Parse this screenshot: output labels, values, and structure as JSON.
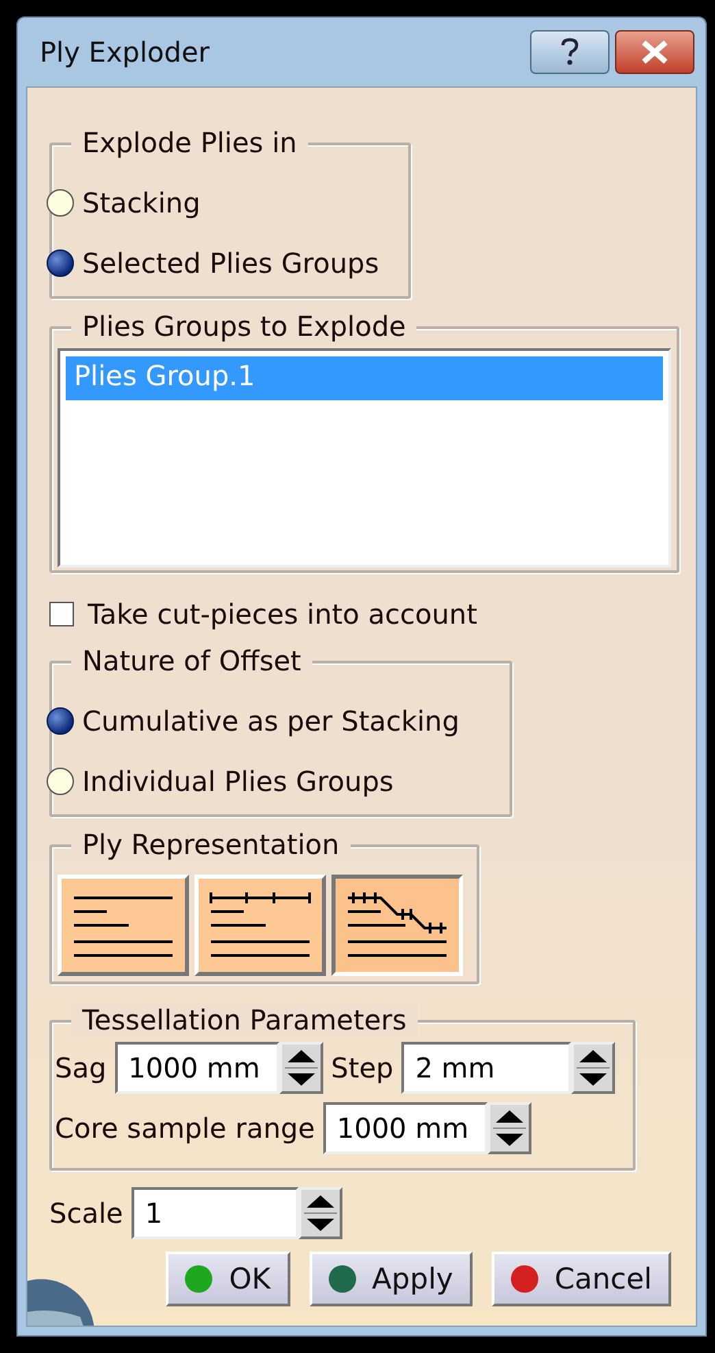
{
  "window": {
    "title": "Ply Exploder"
  },
  "explode_plies_in": {
    "legend": "Explode Plies in",
    "options": [
      {
        "label": "Stacking",
        "selected": false
      },
      {
        "label": "Selected Plies Groups",
        "selected": true
      }
    ]
  },
  "plies_groups_to_explode": {
    "legend": "Plies Groups to Explode",
    "items": [
      {
        "label": "Plies Group.1",
        "selected": true
      }
    ]
  },
  "take_cut_pieces": {
    "label": "Take cut-pieces into account",
    "checked": false
  },
  "nature_of_offset": {
    "legend": "Nature of Offset",
    "options": [
      {
        "label": "Cumulative as per Stacking",
        "selected": true
      },
      {
        "label": "Individual Plies Groups",
        "selected": false
      }
    ]
  },
  "ply_representation": {
    "legend": "Ply Representation",
    "buttons": [
      {
        "kind": "plain",
        "selected": false
      },
      {
        "kind": "ticked",
        "selected": false
      },
      {
        "kind": "stepped",
        "selected": true
      }
    ]
  },
  "tessellation_parameters": {
    "legend": "Tessellation Parameters",
    "fields": [
      {
        "label": "Sag",
        "value": "1000 mm"
      },
      {
        "label": "Step",
        "value": "2 mm"
      },
      {
        "label": "Core sample range",
        "value": "1000 mm"
      }
    ]
  },
  "scale": {
    "label": "Scale",
    "value": "1"
  },
  "buttons": [
    {
      "label": "OK",
      "color": "#1fa81f"
    },
    {
      "label": "Apply",
      "color": "#1f6a4a"
    },
    {
      "label": "Cancel",
      "color": "#d42020"
    }
  ]
}
